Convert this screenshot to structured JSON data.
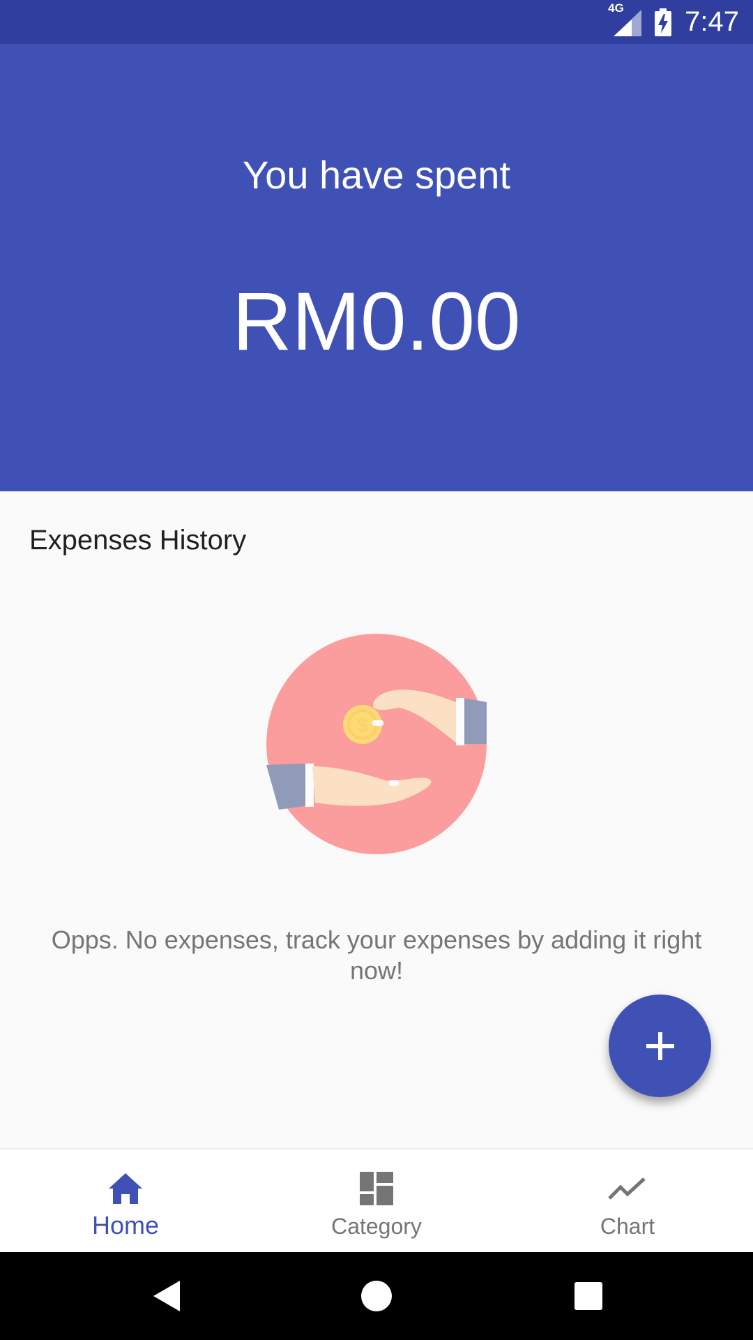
{
  "status_bar": {
    "network": "4G",
    "time": "7:47",
    "icons": [
      "signal-icon",
      "battery-charging-icon"
    ]
  },
  "header": {
    "label": "You have spent",
    "amount": "RM0.00"
  },
  "section": {
    "title": "Expenses History"
  },
  "empty_state": {
    "illustration": "hand-giving-coin-illustration",
    "message": "Opps. No expenses, track your expenses by adding it right now!"
  },
  "fab": {
    "icon": "plus-icon"
  },
  "bottom_nav": {
    "items": [
      {
        "label": "Home",
        "icon": "home-icon",
        "active": true
      },
      {
        "label": "Category",
        "icon": "dashboard-icon",
        "active": false
      },
      {
        "label": "Chart",
        "icon": "trending-up-icon",
        "active": false
      }
    ]
  },
  "system_nav": {
    "icons": [
      "back-icon",
      "home-circle-icon",
      "recents-icon"
    ]
  },
  "colors": {
    "primary": "#3f51b5",
    "primary_dark": "#303f9f",
    "background": "#fafafa",
    "inactive": "#757575"
  }
}
